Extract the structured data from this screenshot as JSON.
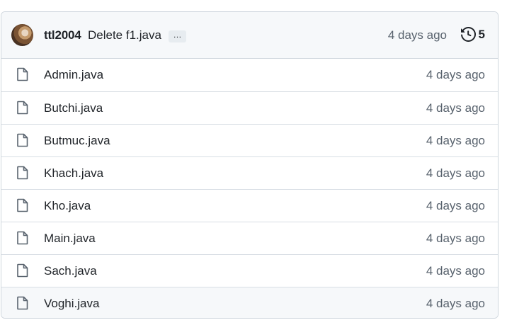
{
  "commit": {
    "author": "ttl2004",
    "message": "Delete f1.java",
    "ellipsis": "…",
    "time": "4 days ago",
    "history_count": "5",
    "history_icon": "history-icon"
  },
  "files": [
    {
      "name": "Admin.java",
      "time": "4 days ago"
    },
    {
      "name": "Butchi.java",
      "time": "4 days ago"
    },
    {
      "name": "Butmuc.java",
      "time": "4 days ago"
    },
    {
      "name": "Khach.java",
      "time": "4 days ago"
    },
    {
      "name": "Kho.java",
      "time": "4 days ago"
    },
    {
      "name": "Main.java",
      "time": "4 days ago"
    },
    {
      "name": "Sach.java",
      "time": "4 days ago"
    },
    {
      "name": "Voghi.java",
      "time": "4 days ago"
    }
  ],
  "colors": {
    "border": "#d0d7de",
    "header_bg": "#f6f8fa",
    "muted_text": "#59636e",
    "text": "#1f2328"
  },
  "file_icon": "file-icon"
}
